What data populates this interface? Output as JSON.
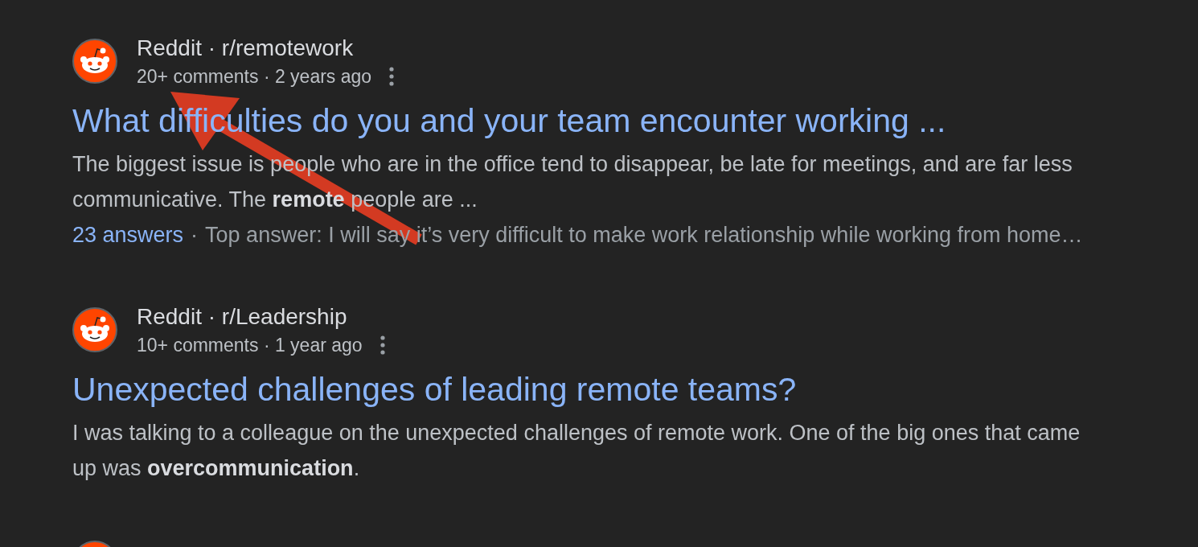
{
  "results": [
    {
      "source_line": "Reddit · r/remotework",
      "meta": "20+ comments · 2 years ago",
      "title": "What difficulties do you and your team encounter working ...",
      "snippet": "The biggest issue is people who are in the office tend to disappear, be late for meetings, and are far less communicative. The **remote** people are ...",
      "answers": {
        "link": "23 answers",
        "separator": "·",
        "top_answer": "Top answer: I will say it’s very difficult to make work relationship while working from home…"
      }
    },
    {
      "source_line": "Reddit · r/Leadership",
      "meta": "10+ comments · 1 year ago",
      "title": "Unexpected challenges of leading remote teams?",
      "snippet": "I was talking to a colleague on the unexpected challenges of remote work. One of the big ones that came up was **overcommunication**."
    },
    {
      "cut_off": true
    }
  ],
  "annotations": [
    {
      "kind": "arrow"
    }
  ]
}
